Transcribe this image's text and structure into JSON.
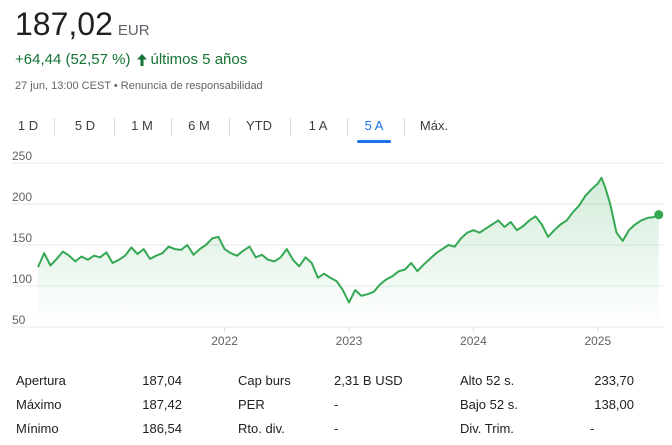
{
  "quote": {
    "price": "187,02",
    "currency": "EUR",
    "change": "+64,44 (52,57 %)",
    "period": "últimos 5 años",
    "timestamp": "27 jun, 13:00 CEST",
    "disclaimer": "Renuncia de responsabilidad",
    "meta_separator": "•"
  },
  "colors": {
    "positive": "#137333",
    "line": "#34a853",
    "accent": "#1a73e8"
  },
  "tabs": [
    {
      "label": "1 D",
      "active": false
    },
    {
      "label": "5 D",
      "active": false
    },
    {
      "label": "1 M",
      "active": false
    },
    {
      "label": "6 M",
      "active": false
    },
    {
      "label": "YTD",
      "active": false
    },
    {
      "label": "1 A",
      "active": false
    },
    {
      "label": "5 A",
      "active": true
    },
    {
      "label": "Máx.",
      "active": false
    }
  ],
  "chart_data": {
    "type": "area",
    "y_ticks": [
      "250",
      "200",
      "150",
      "100",
      "50"
    ],
    "y_tick_values": [
      250,
      200,
      150,
      100,
      50
    ],
    "x_ticks": [
      "2022",
      "2023",
      "2024",
      "2025"
    ],
    "x_tick_values": [
      2022,
      2023,
      2024,
      2025
    ],
    "ylim": [
      50,
      250
    ],
    "xlim": [
      2020.5,
      2025.5
    ],
    "grid": true,
    "series": [
      {
        "x": [
          2020.5,
          2020.55,
          2020.6,
          2020.65,
          2020.7,
          2020.75,
          2020.8,
          2020.85,
          2020.9,
          2020.95,
          2021.0,
          2021.05,
          2021.1,
          2021.15,
          2021.2,
          2021.25,
          2021.3,
          2021.35,
          2021.4,
          2021.45,
          2021.5,
          2021.55,
          2021.6,
          2021.65,
          2021.7,
          2021.75,
          2021.8,
          2021.85,
          2021.9,
          2021.95,
          2022.0,
          2022.05,
          2022.1,
          2022.15,
          2022.2,
          2022.25,
          2022.3,
          2022.35,
          2022.4,
          2022.45,
          2022.5,
          2022.55,
          2022.6,
          2022.65,
          2022.7,
          2022.75,
          2022.8,
          2022.85,
          2022.9,
          2022.95,
          2023.0,
          2023.05,
          2023.1,
          2023.15,
          2023.2,
          2023.25,
          2023.3,
          2023.35,
          2023.4,
          2023.45,
          2023.5,
          2023.55,
          2023.6,
          2023.65,
          2023.7,
          2023.75,
          2023.8,
          2023.85,
          2023.9,
          2023.95,
          2024.0,
          2024.05,
          2024.1,
          2024.15,
          2024.2,
          2024.25,
          2024.3,
          2024.35,
          2024.4,
          2024.45,
          2024.5,
          2024.55,
          2024.6,
          2024.65,
          2024.7,
          2024.75,
          2024.8,
          2024.85,
          2024.9,
          2024.95,
          2025.0,
          2025.03,
          2025.06,
          2025.1,
          2025.15,
          2025.2,
          2025.25,
          2025.3,
          2025.35,
          2025.4,
          2025.45,
          2025.49
        ],
        "y": [
          123,
          140,
          125,
          133,
          142,
          137,
          130,
          136,
          132,
          137,
          135,
          141,
          128,
          132,
          137,
          147,
          139,
          145,
          133,
          137,
          140,
          148,
          145,
          144,
          150,
          138,
          145,
          150,
          158,
          160,
          145,
          140,
          137,
          143,
          148,
          135,
          138,
          132,
          130,
          135,
          145,
          132,
          124,
          135,
          128,
          110,
          115,
          110,
          106,
          95,
          80,
          95,
          88,
          90,
          93,
          102,
          108,
          112,
          118,
          120,
          128,
          118,
          126,
          133,
          140,
          145,
          150,
          148,
          158,
          165,
          168,
          165,
          170,
          175,
          180,
          172,
          178,
          168,
          173,
          180,
          185,
          175,
          160,
          168,
          175,
          180,
          190,
          198,
          210,
          218,
          225,
          232,
          220,
          200,
          165,
          155,
          168,
          175,
          180,
          183,
          184,
          187
        ]
      }
    ]
  },
  "stats": [
    {
      "label": "Apertura",
      "value": "187,04"
    },
    {
      "label": "Máximo",
      "value": "187,42"
    },
    {
      "label": "Mínimo",
      "value": "186,54"
    },
    {
      "label": "Cap burs",
      "value": "2,31 B USD"
    },
    {
      "label": "PER",
      "value": "-"
    },
    {
      "label": "Rto. div.",
      "value": "-"
    },
    {
      "label": "Alto 52 s.",
      "value": "233,70"
    },
    {
      "label": "Bajo 52 s.",
      "value": "138,00"
    },
    {
      "label": "Div. Trim.",
      "value": "-"
    }
  ]
}
